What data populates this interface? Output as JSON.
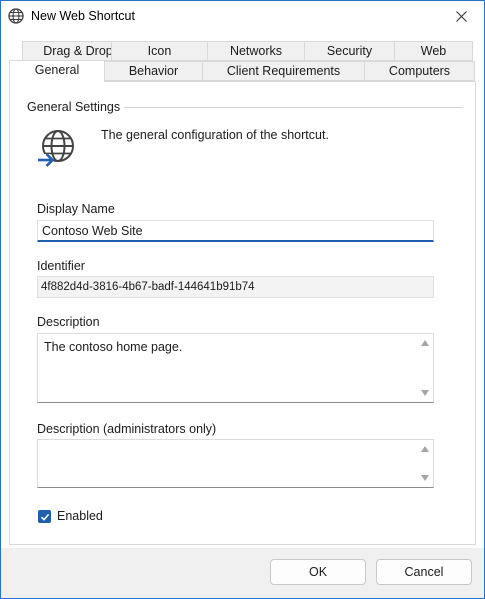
{
  "window": {
    "title": "New Web Shortcut"
  },
  "tabs_row1": [
    {
      "label": "Drag & Drop"
    },
    {
      "label": "Icon"
    },
    {
      "label": "Networks"
    },
    {
      "label": "Security"
    },
    {
      "label": "Web"
    }
  ],
  "tabs_row2": [
    {
      "label": "General",
      "active": true
    },
    {
      "label": "Behavior"
    },
    {
      "label": "Client Requirements"
    },
    {
      "label": "Computers"
    }
  ],
  "general": {
    "group_title": "General Settings",
    "description_text": "The general configuration of the shortcut.",
    "icon": "globe-arrow-icon"
  },
  "fields": {
    "display_name": {
      "label": "Display Name",
      "value": "Contoso Web Site"
    },
    "identifier": {
      "label": "Identifier",
      "value": "4f882d4d-3816-4b67-badf-144641b91b74"
    },
    "description": {
      "label": "Description",
      "value": "The contoso home page."
    },
    "admin_description": {
      "label": "Description (administrators only)",
      "value": ""
    }
  },
  "enabled": {
    "label": "Enabled",
    "checked": true
  },
  "buttons": {
    "ok": "OK",
    "cancel": "Cancel"
  },
  "colors": {
    "accent": "#1f5fae",
    "border": "#2b73c7"
  }
}
